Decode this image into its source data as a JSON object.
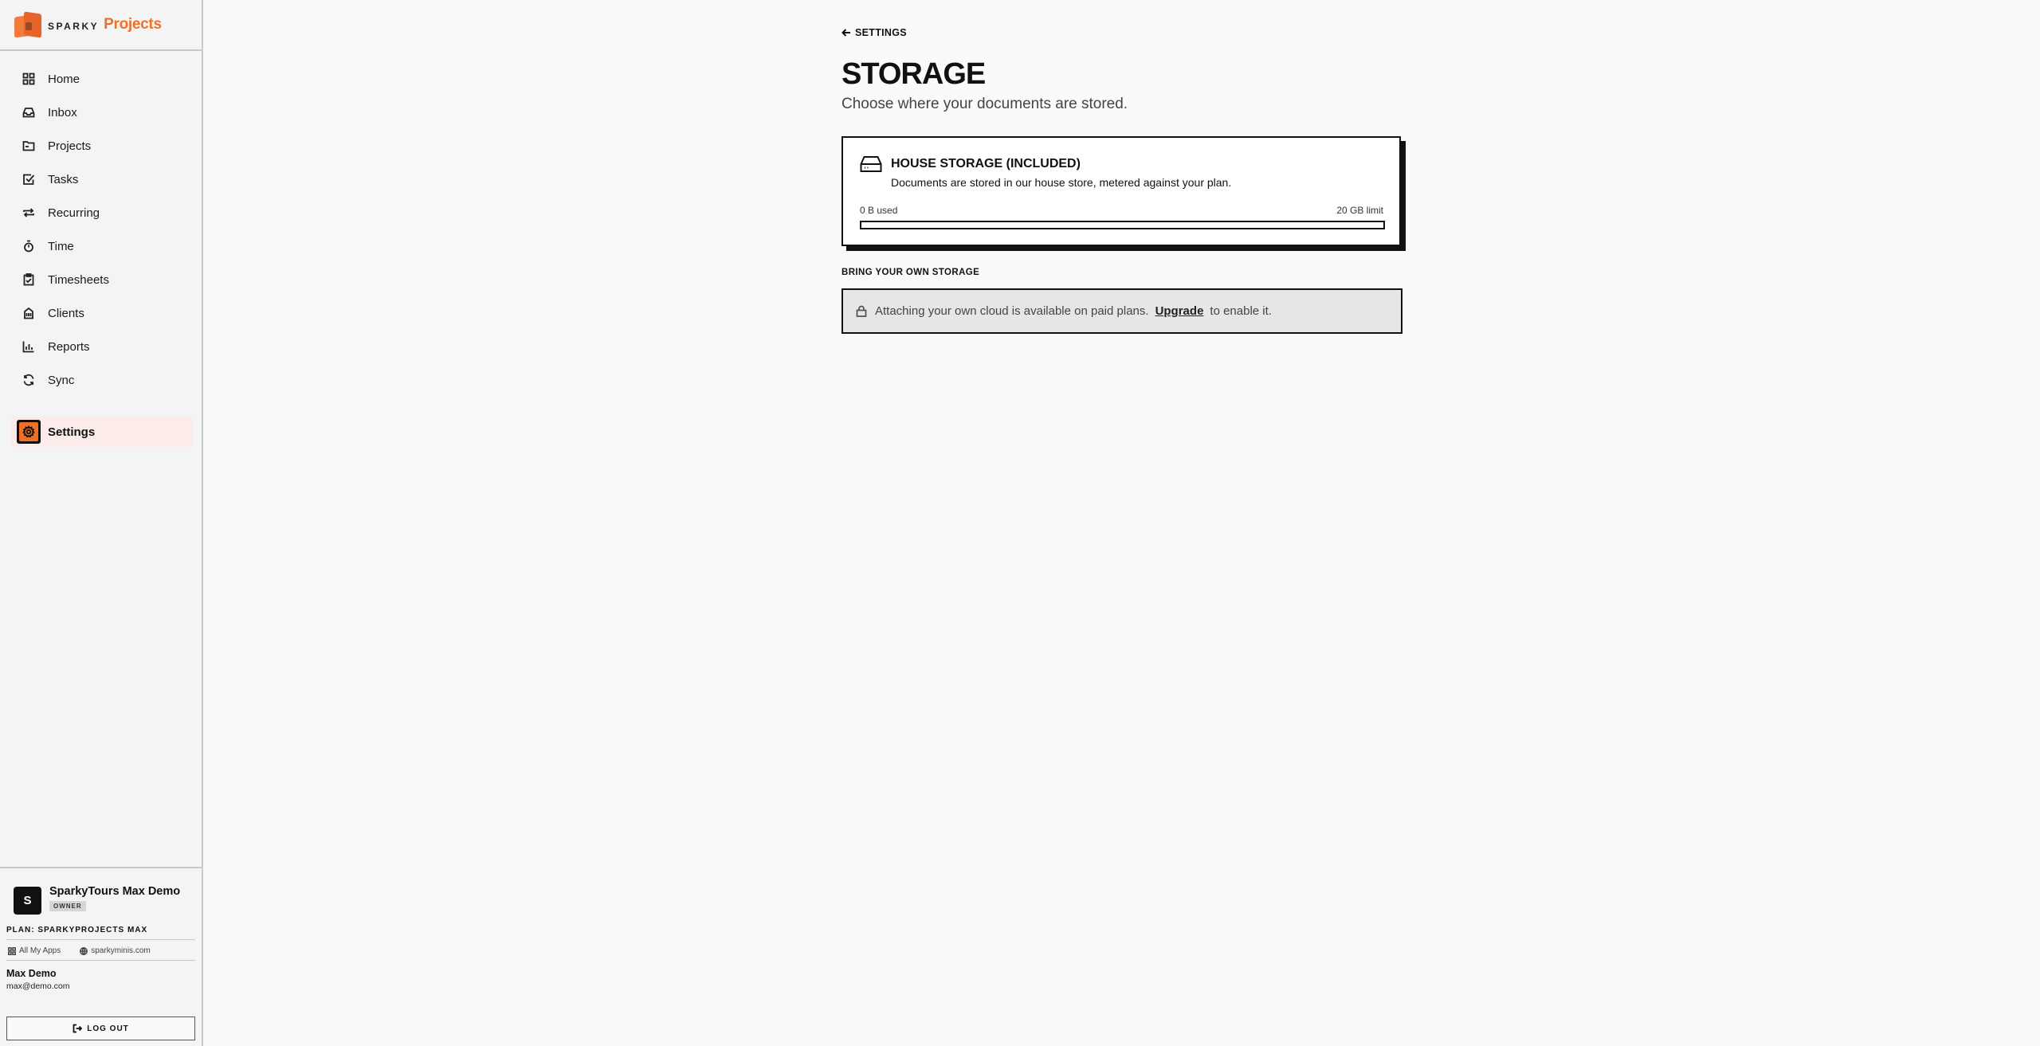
{
  "brand": {
    "small": "SPARKY",
    "name": "Projects",
    "accent": "#f07028"
  },
  "nav": {
    "items": [
      {
        "label": "Home",
        "icon": "home-grid-icon"
      },
      {
        "label": "Inbox",
        "icon": "inbox-icon"
      },
      {
        "label": "Projects",
        "icon": "folder-icon"
      },
      {
        "label": "Tasks",
        "icon": "checkbox-icon"
      },
      {
        "label": "Recurring",
        "icon": "repeat-icon"
      },
      {
        "label": "Time",
        "icon": "stopwatch-icon"
      },
      {
        "label": "Timesheets",
        "icon": "clipboard-check-icon"
      },
      {
        "label": "Clients",
        "icon": "building-icon"
      },
      {
        "label": "Reports",
        "icon": "bar-chart-icon"
      },
      {
        "label": "Sync",
        "icon": "refresh-icon"
      }
    ],
    "active": {
      "label": "Settings",
      "icon": "gear-icon"
    }
  },
  "account": {
    "avatar_letter": "S",
    "org_name": "SparkyTours Max Demo",
    "role": "OWNER",
    "plan": "PLAN: SPARKYPROJECTS MAX",
    "links": {
      "all_apps": "All My Apps",
      "site": "sparkyminis.com"
    },
    "user_name": "Max Demo",
    "user_email": "max@demo.com",
    "logout_label": "LOG OUT"
  },
  "page": {
    "back_label": "SETTINGS",
    "title": "STORAGE",
    "subtitle": "Choose where your documents are stored."
  },
  "house_storage": {
    "title": "HOUSE STORAGE (INCLUDED)",
    "description": "Documents are stored in our house store, metered against your plan.",
    "used_label": "0 B used",
    "limit_label": "20 GB limit",
    "usage_fraction": 0
  },
  "byo": {
    "heading": "BRING YOUR OWN STORAGE",
    "message": "Attaching your own cloud is available on paid plans.",
    "upgrade_label": "Upgrade",
    "suffix": "to enable it."
  }
}
